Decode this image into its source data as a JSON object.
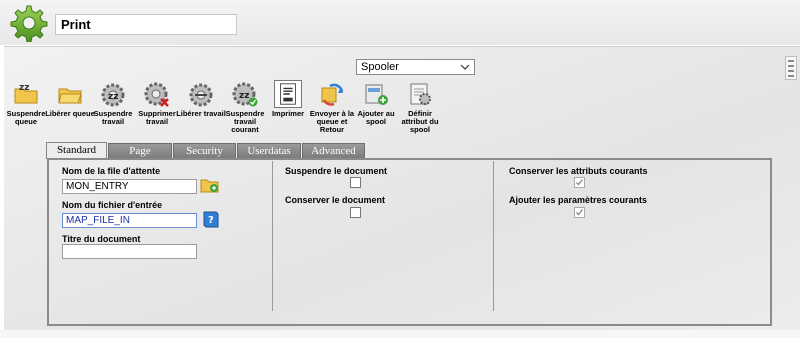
{
  "window": {
    "title": "Print"
  },
  "spooler": {
    "selected": "Spooler"
  },
  "toolbar": [
    {
      "label": "Suspendre queue"
    },
    {
      "label": "Libérer queue"
    },
    {
      "label": "Suspendre travail"
    },
    {
      "label": "Supprimer travail"
    },
    {
      "label": "Libérer travail"
    },
    {
      "label": "Suspendre travail courant"
    },
    {
      "label": "Imprimer"
    },
    {
      "label": "Envoyer à la queue et Retour"
    },
    {
      "label": "Ajouter au spool"
    },
    {
      "label": "Définir attribut du spool"
    }
  ],
  "tabs": [
    {
      "label": "Standard",
      "selected": true
    },
    {
      "label": "Page"
    },
    {
      "label": "Security"
    },
    {
      "label": "Userdatas"
    },
    {
      "label": "Advanced"
    }
  ],
  "form": {
    "queue_name_label": "Nom de la file d'attente",
    "queue_name_value": "MON_ENTRY",
    "input_file_label": "Nom du fichier d'entrée",
    "input_file_value": "MAP_FILE_IN",
    "doc_title_label": "Titre du document",
    "doc_title_value": "",
    "suspend_doc_label": "Suspendre le document",
    "suspend_doc_checked": false,
    "keep_doc_label": "Conserver le document",
    "keep_doc_checked": false,
    "keep_attrs_label": "Conserver les attributs courants",
    "keep_attrs_checked": true,
    "add_params_label": "Ajouter les paramètres courants",
    "add_params_checked": true
  },
  "colors": {
    "tab_inactive": "#8a8a8a",
    "logo_green": "#5fa82a",
    "field_blue_text": "#1b2fa8"
  }
}
